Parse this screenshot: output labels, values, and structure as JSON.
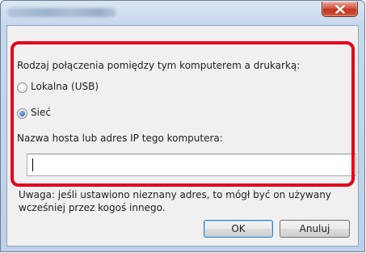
{
  "dialog": {
    "close_glyph": "✕"
  },
  "connection": {
    "question": "Rodzaj połączenia pomiędzy tym komputerem a drukarką:",
    "option_local": "Lokalna (USB)",
    "option_network": "Sieć",
    "selected": "Sieć"
  },
  "host": {
    "label": "Nazwa hosta lub adres IP tego komputera:",
    "value": ""
  },
  "warning": {
    "line1": "Uwaga: jeśli ustawiono nieznany adres, to mógł być on używany",
    "line2": "wcześniej przez kogoś innego."
  },
  "buttons": {
    "ok": "OK",
    "cancel": "Anuluj"
  },
  "icons": {
    "close": "close-icon"
  },
  "colors": {
    "highlight": "#e3001b",
    "close_button": "#c2321d"
  }
}
